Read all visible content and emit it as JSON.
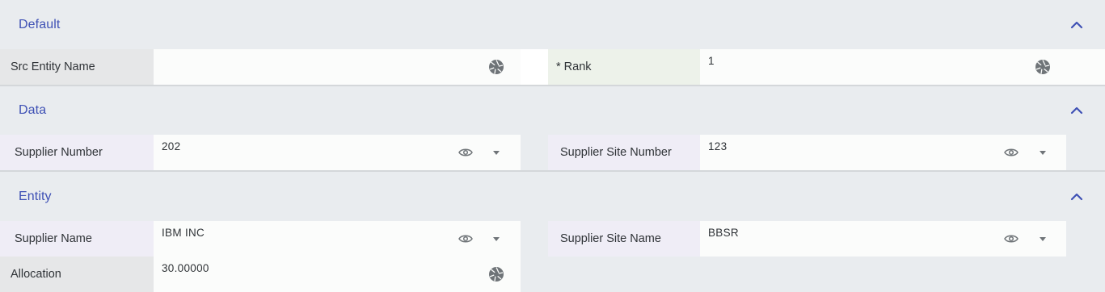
{
  "sections": {
    "default": {
      "title": "Default"
    },
    "data": {
      "title": "Data"
    },
    "entity": {
      "title": "Entity"
    }
  },
  "fields": {
    "src_entity_name": {
      "label": "Src Entity Name",
      "value": ""
    },
    "rank": {
      "label": "* Rank",
      "value": "1"
    },
    "supplier_number": {
      "label": "Supplier Number",
      "value": "202"
    },
    "supplier_site_number": {
      "label": "Supplier Site Number",
      "value": "123"
    },
    "supplier_name": {
      "label": "Supplier Name",
      "value": "IBM INC"
    },
    "supplier_site_name": {
      "label": "Supplier Site Name",
      "value": "BBSR"
    },
    "allocation": {
      "label": "Allocation",
      "value": "30.00000"
    }
  },
  "icons": {
    "collapse": "chevron-up-icon",
    "shutter": "aperture-icon",
    "eye": "eye-icon",
    "dropdown": "caret-down-icon"
  },
  "colors": {
    "accent": "#3f51b5",
    "header_bg": "#e9ecef",
    "icon_gray": "#6f7478"
  }
}
